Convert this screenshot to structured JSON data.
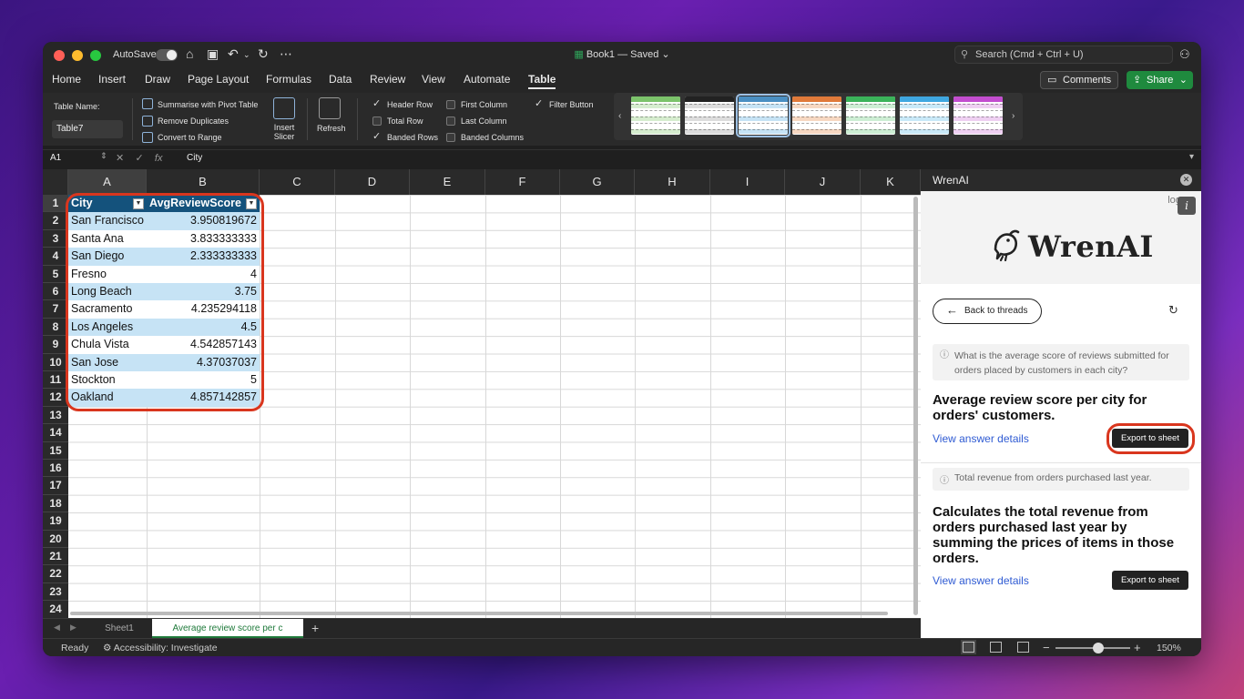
{
  "titlebar": {
    "autosave_label": "AutoSave",
    "doc_title": "Book1 — Saved",
    "search_placeholder": "Search (Cmd + Ctrl + U)"
  },
  "menu": [
    "Home",
    "Insert",
    "Draw",
    "Page Layout",
    "Formulas",
    "Data",
    "Review",
    "View",
    "Automate",
    "Table"
  ],
  "menu_active": "Table",
  "buttons": {
    "comments": "Comments",
    "share": "Share"
  },
  "ribbon": {
    "table_name_label": "Table Name:",
    "table_name_value": "Table7",
    "tools": [
      "Summarise with Pivot Table",
      "Remove Duplicates",
      "Convert to Range"
    ],
    "insert_slicer": [
      "Insert",
      "Slicer"
    ],
    "refresh": "Refresh",
    "options": [
      {
        "label": "Header Row",
        "checked": true
      },
      {
        "label": "Total Row",
        "checked": false
      },
      {
        "label": "Banded Rows",
        "checked": true
      },
      {
        "label": "First Column",
        "checked": false
      },
      {
        "label": "Last Column",
        "checked": false
      },
      {
        "label": "Banded Columns",
        "checked": false
      },
      {
        "label": "Filter Button",
        "checked": true
      }
    ],
    "style_colors": [
      "#7cc36b",
      "#222222",
      "#4a8fc2",
      "#e07a3a",
      "#3bb35a",
      "#3fa7e0",
      "#c34dcf"
    ]
  },
  "formula_bar": {
    "cell_ref": "A1",
    "fx": "fx",
    "value": "City"
  },
  "columns": [
    "A",
    "B",
    "C",
    "D",
    "E",
    "F",
    "G",
    "H",
    "I",
    "J",
    "K"
  ],
  "rows": [
    "1",
    "2",
    "3",
    "4",
    "5",
    "6",
    "7",
    "8",
    "9",
    "10",
    "11",
    "12",
    "13",
    "14",
    "15",
    "16",
    "17",
    "18",
    "19",
    "20",
    "21",
    "22",
    "23",
    "24"
  ],
  "table": {
    "headers": [
      "City",
      "AvgReviewScore"
    ],
    "rows": [
      [
        "San Francisco",
        "3.950819672"
      ],
      [
        "Santa Ana",
        "3.833333333"
      ],
      [
        "San Diego",
        "2.333333333"
      ],
      [
        "Fresno",
        "4"
      ],
      [
        "Long Beach",
        "3.75"
      ],
      [
        "Sacramento",
        "4.235294118"
      ],
      [
        "Los Angeles",
        "4.5"
      ],
      [
        "Chula Vista",
        "4.542857143"
      ],
      [
        "San Jose",
        "4.37037037"
      ],
      [
        "Stockton",
        "5"
      ],
      [
        "Oakland",
        "4.857142857"
      ]
    ]
  },
  "panel": {
    "title": "WrenAI",
    "logo_alt": "logo",
    "logo_text": "WrenAI",
    "back_label": "Back to threads",
    "question1": "What is the average score of reviews submitted for orders placed by customers in each city?",
    "answer1_title": "Average review score per city for orders' customers.",
    "view_details": "View answer details",
    "export_label": "Export to sheet",
    "question2": "Total revenue from orders purchased last year.",
    "answer2_title": "Calculates the total revenue from orders purchased last year by summing the prices of items in those orders."
  },
  "sheet_tabs": [
    "Sheet1",
    "Average review score per c"
  ],
  "status": {
    "ready": "Ready",
    "accessibility": "Accessibility: Investigate",
    "zoom": "150%"
  }
}
